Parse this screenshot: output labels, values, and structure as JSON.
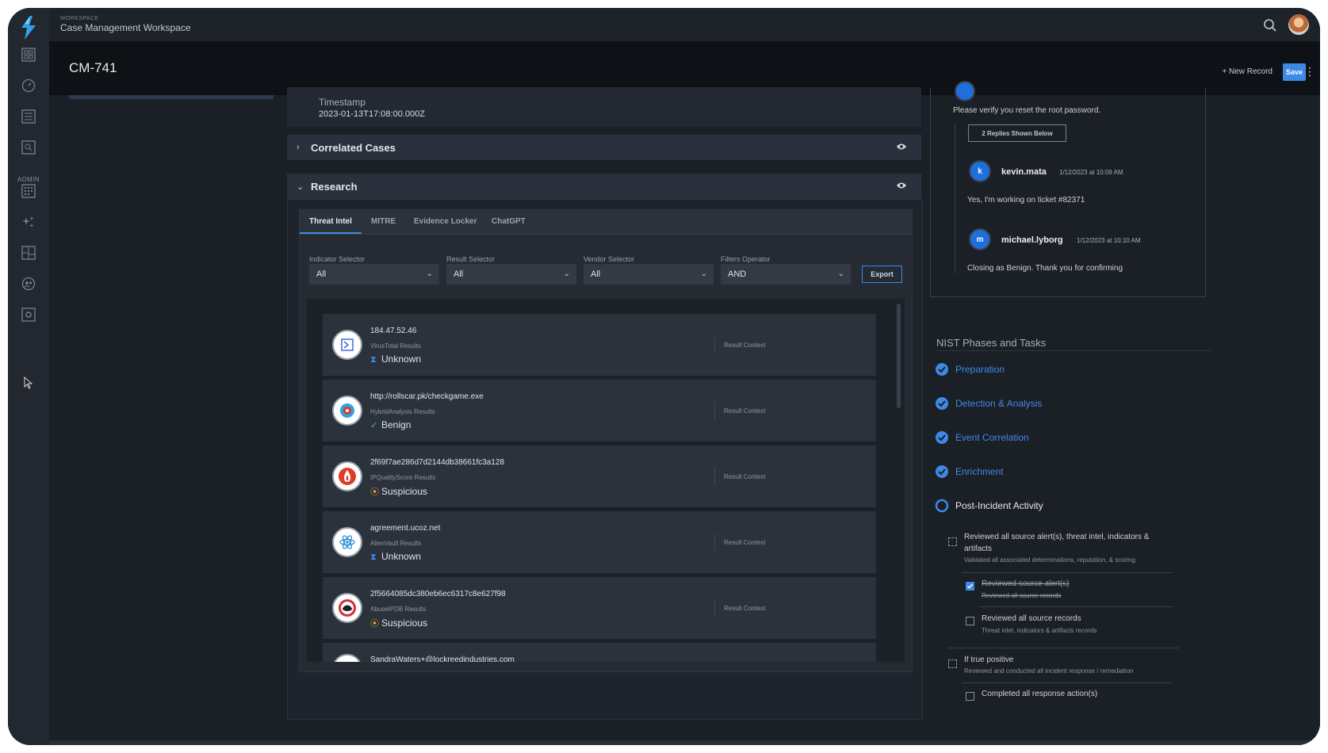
{
  "workspace": {
    "small_label": "WORKSPACE",
    "title": "Case Management Workspace"
  },
  "nav": {
    "admin_label": "ADMIN"
  },
  "header": {
    "case_id": "CM-741",
    "new_record_label": "+ New Record",
    "save_label": "Save"
  },
  "timestamp": {
    "label": "Timestamp",
    "value": "2023-01-13T17:08:00.000Z"
  },
  "panels": {
    "correlated_cases": "Correlated Cases",
    "research": "Research"
  },
  "tabs": [
    "Threat Intel",
    "MITRE",
    "Evidence Locker",
    "ChatGPT"
  ],
  "filters": [
    {
      "label": "Indicator Selector",
      "value": "All"
    },
    {
      "label": "Result Selector",
      "value": "All"
    },
    {
      "label": "Vendor Selector",
      "value": "All"
    },
    {
      "label": "Filters Operator",
      "value": "AND"
    }
  ],
  "export_label": "Export",
  "results": [
    {
      "indicator": "184.47.52.46",
      "source": "VirusTotal Results",
      "verdict": "Unknown",
      "verdict_icon": "hourglass-icon",
      "context": "Result Context",
      "logo": "virustotal-logo",
      "color": "#3d6fe0"
    },
    {
      "indicator": "http://rollscar.pk/checkgame.exe",
      "source": "HybridAnalysis Results",
      "verdict": "Benign",
      "verdict_icon": "check-icon",
      "context": "Result Context",
      "logo": "hybridanalysis-logo",
      "color": "#2fa3e6"
    },
    {
      "indicator": "2f69f7ae286d7d2144db38661fc3a128",
      "source": "IPQualityScore Results",
      "verdict": "Suspicious",
      "verdict_icon": "warning-icon",
      "context": "Result Context",
      "logo": "ipqualityscore-logo",
      "color": "#e03a2a"
    },
    {
      "indicator": "agreement.ucoz.net",
      "source": "AlienVault Results",
      "verdict": "Unknown",
      "verdict_icon": "hourglass-icon",
      "context": "Result Context",
      "logo": "alienvault-logo",
      "color": "#2f8fd8"
    },
    {
      "indicator": "2f5664085dc380eb6ec6317c8e627f98",
      "source": "AbuseIPDB Results",
      "verdict": "Suspicious",
      "verdict_icon": "warning-icon",
      "context": "Result Context",
      "logo": "abuseipdb-logo",
      "color": "#d62f2f"
    },
    {
      "indicator": "SandraWaters+@lockreedindustries.com",
      "source": "",
      "verdict": "",
      "verdict_icon": "",
      "context": "",
      "logo": "",
      "color": "#888888"
    }
  ],
  "comments": {
    "message": "Please verify you reset the root password.",
    "replies_label": "2 Replies Shown Below",
    "replies": [
      {
        "initial": "k",
        "user": "kevin.mata",
        "time": "1/12/2023 at 10:09 AM",
        "text": "Yes, I'm working on ticket #82371"
      },
      {
        "initial": "m",
        "user": "michael.lyborg",
        "time": "1/12/2023 at 10:10 AM",
        "text": "Closing as Benign. Thank you for confirming"
      }
    ]
  },
  "nist": {
    "title": "NIST Phases and Tasks",
    "phases": [
      {
        "label": "Preparation",
        "done": true
      },
      {
        "label": "Detection & Analysis",
        "done": true
      },
      {
        "label": "Event Correlation",
        "done": true
      },
      {
        "label": "Enrichment",
        "done": true
      },
      {
        "label": "Post-Incident Activity",
        "done": false
      }
    ],
    "tasks": {
      "t1_title": "Reviewed all source alert(s), threat intel, indicators &",
      "t1_title2": "artifacts",
      "t1_sub": "Validated all associated determinations, reputation, & scoring",
      "t1a_title": "Reviewed source alert(s)",
      "t1a_sub": "Reviewed all source records",
      "t1b_title": "Reviewed all source records",
      "t1b_sub": "Threat intel, indicators & artifacts records",
      "t2_title": "If true positive",
      "t2_sub": "Reviewed and conducted all incident response / remediation",
      "t2a_title": "Completed all response action(s)"
    }
  },
  "colors": {
    "accent": "#3d8ae6",
    "warning": "#f0a020",
    "success": "#3fc47a"
  }
}
